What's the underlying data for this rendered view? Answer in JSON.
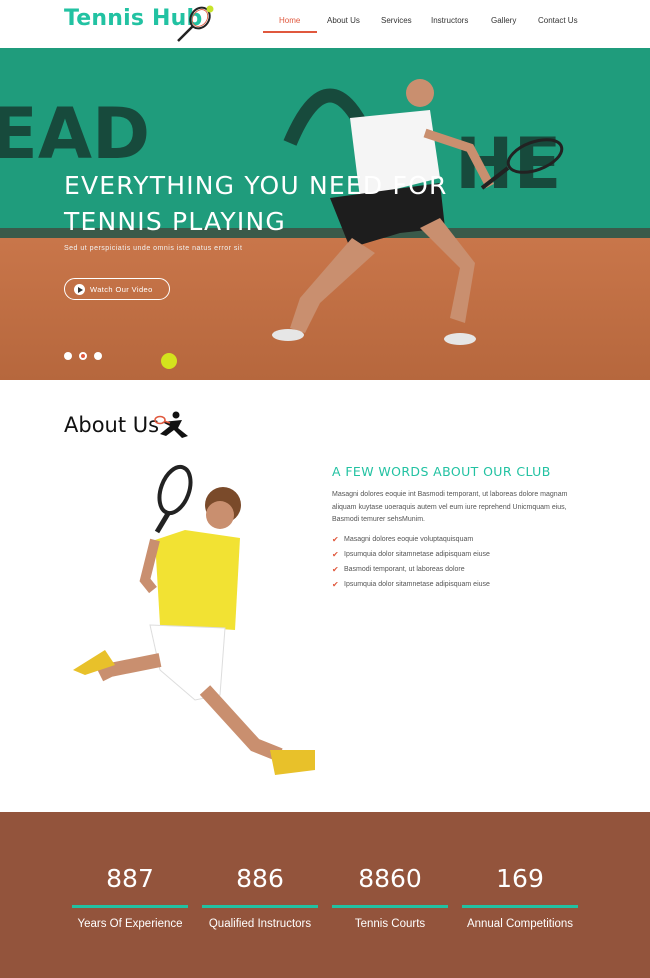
{
  "header": {
    "logo_text": "Tennis Hub",
    "nav": [
      "Home",
      "About Us",
      "Services",
      "Instructors",
      "Gallery",
      "Contact Us"
    ],
    "active_index": 0
  },
  "hero": {
    "title_line1": "EVERYTHING YOU NEED FOR",
    "title_line2": "TENNIS PLAYING",
    "subtitle": "Sed ut perspiciatis unde omnis iste natus error sit",
    "button_label": "Watch Our Video",
    "slides": 3,
    "active_slide": 1
  },
  "about": {
    "title": "About Us",
    "heading": "A FEW WORDS ABOUT OUR CLUB",
    "paragraph": "Masagni dolores eoquie int Basmodi temporant, ut laboreas dolore magnam aliquam kuytase uoeraquis autem vel eum iure reprehend Unicmquam eius, Basmodi temurer sehsMunim.",
    "list": [
      "Masagni dolores eoquie voluptaquisquam",
      "Ipsumquia dolor sitamnetase adipisquam eiuse",
      "Basmodi temporant, ut laboreas dolore",
      "Ipsumquia dolor sitamnetase adipisquam eiuse"
    ]
  },
  "stats": [
    {
      "value": "887",
      "label": "Years Of Experience"
    },
    {
      "value": "886",
      "label": "Qualified Instructors"
    },
    {
      "value": "8860",
      "label": "Tennis Courts"
    },
    {
      "value": "169",
      "label": "Annual Competitions"
    }
  ],
  "colors": {
    "accent_teal": "#22c2a2",
    "accent_red": "#e0583d",
    "stats_bg": "#93543c"
  }
}
